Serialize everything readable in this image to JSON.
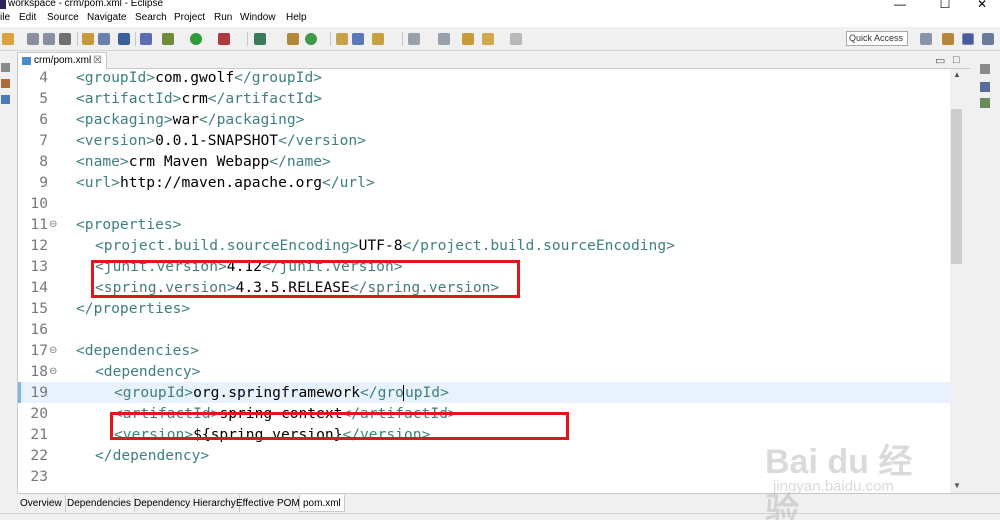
{
  "window": {
    "title": "workspace - crm/pom.xml - Eclipse",
    "minimize": "—",
    "maximize": "☐",
    "close": "✕"
  },
  "menu": [
    "ile",
    "Edit",
    "Source",
    "Navigate",
    "Search",
    "Project",
    "Run",
    "Window",
    "Help"
  ],
  "toolbar": {
    "quick_access": "Quick Access"
  },
  "editor_tab": {
    "label": "crm/pom.xml",
    "close": "☒"
  },
  "editor": {
    "lines": [
      {
        "num": "4",
        "indent": 0,
        "tokens": [
          [
            "t",
            "<groupId>"
          ],
          [
            "x",
            "com.gwolf"
          ],
          [
            "t",
            "</groupId>"
          ]
        ]
      },
      {
        "num": "5",
        "indent": 0,
        "tokens": [
          [
            "t",
            "<artifactId>"
          ],
          [
            "x",
            "crm"
          ],
          [
            "t",
            "</artifactId>"
          ]
        ]
      },
      {
        "num": "6",
        "indent": 0,
        "tokens": [
          [
            "t",
            "<packaging>"
          ],
          [
            "x",
            "war"
          ],
          [
            "t",
            "</packaging>"
          ]
        ]
      },
      {
        "num": "7",
        "indent": 0,
        "tokens": [
          [
            "t",
            "<version>"
          ],
          [
            "x",
            "0.0.1-SNAPSHOT"
          ],
          [
            "t",
            "</version>"
          ]
        ]
      },
      {
        "num": "8",
        "indent": 0,
        "tokens": [
          [
            "t",
            "<name>"
          ],
          [
            "x",
            "crm Maven Webapp"
          ],
          [
            "t",
            "</name>"
          ]
        ]
      },
      {
        "num": "9",
        "indent": 0,
        "tokens": [
          [
            "t",
            "<url>"
          ],
          [
            "x",
            "http://maven.apache.org"
          ],
          [
            "t",
            "</url>"
          ]
        ]
      },
      {
        "num": "10",
        "indent": 0,
        "tokens": []
      },
      {
        "num": "11",
        "indent": 0,
        "fold": "⊖",
        "tokens": [
          [
            "t",
            "<properties>"
          ]
        ]
      },
      {
        "num": "12",
        "indent": 1,
        "tokens": [
          [
            "t",
            "<project.build.sourceEncoding>"
          ],
          [
            "x",
            "UTF-8"
          ],
          [
            "t",
            "</project.build.sourceEncoding>"
          ]
        ]
      },
      {
        "num": "13",
        "indent": 1,
        "tokens": [
          [
            "t",
            "<junit.version>"
          ],
          [
            "x",
            "4.12"
          ],
          [
            "t",
            "</junit.version>"
          ]
        ]
      },
      {
        "num": "14",
        "indent": 1,
        "tokens": [
          [
            "t",
            "<spring.version>"
          ],
          [
            "x",
            "4.3.5.RELEASE"
          ],
          [
            "t",
            "</spring.version>"
          ]
        ]
      },
      {
        "num": "15",
        "indent": 0,
        "tokens": [
          [
            "t",
            "</properties>"
          ]
        ]
      },
      {
        "num": "16",
        "indent": 0,
        "tokens": []
      },
      {
        "num": "17",
        "indent": 0,
        "fold": "⊖",
        "tokens": [
          [
            "t",
            "<dependencies>"
          ]
        ]
      },
      {
        "num": "18",
        "indent": 1,
        "fold": "⊖",
        "tokens": [
          [
            "t",
            "<dependency>"
          ]
        ]
      },
      {
        "num": "19",
        "indent": 2,
        "current": true,
        "tokens": [
          [
            "t",
            "<groupId>"
          ],
          [
            "x",
            "org.springframework"
          ],
          [
            "t",
            "</gro"
          ],
          [
            "c",
            ""
          ],
          [
            "t",
            "upId>"
          ]
        ]
      },
      {
        "num": "20",
        "indent": 2,
        "tokens": [
          [
            "t",
            "<artifactId>"
          ],
          [
            "x",
            "spring-context"
          ],
          [
            "t",
            "</artifactId>"
          ]
        ]
      },
      {
        "num": "21",
        "indent": 2,
        "tokens": [
          [
            "t",
            "<version>"
          ],
          [
            "x",
            "${spring.version}"
          ],
          [
            "t",
            "</version>"
          ]
        ]
      },
      {
        "num": "22",
        "indent": 1,
        "tokens": [
          [
            "t",
            "</dependency>"
          ]
        ]
      },
      {
        "num": "23",
        "indent": 0,
        "tokens": []
      }
    ]
  },
  "bottom_tabs": [
    "Overview",
    "Dependencies",
    "Dependency Hierarchy",
    "Effective POM",
    "pom.xml"
  ],
  "active_bottom_tab": "pom.xml",
  "watermark": {
    "main": "Bai du 经验",
    "sub": "jingyan.baidu.com"
  },
  "colors": {
    "tag": "#3f7f7f",
    "text": "#000000",
    "highlight_box": "#e0161c",
    "current_line": "#e8f2fe"
  }
}
